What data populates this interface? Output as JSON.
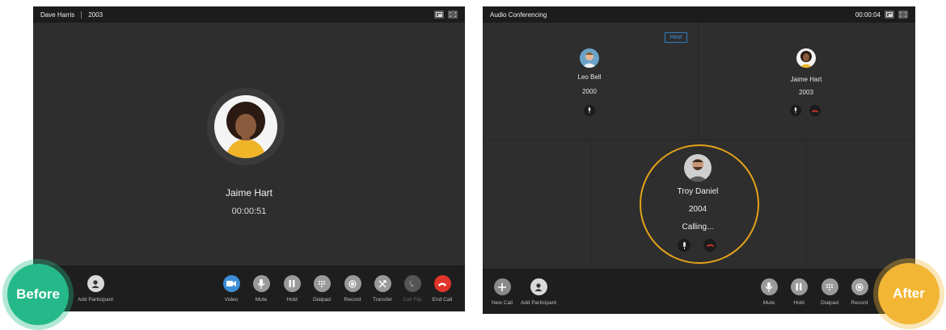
{
  "before": {
    "title_name": "Dave Harris",
    "title_ext": "2003",
    "callee_name": "Jaime Hart",
    "timer": "00:00:51",
    "controls": {
      "add_participant": "Add Participant",
      "video": "Video",
      "mute": "Mute",
      "hold": "Hold",
      "dialpad": "Dialpad",
      "record": "Record",
      "transfer": "Transfer",
      "call_flip": "Call Flip",
      "end_call": "End Call"
    },
    "badge": "Before",
    "badge_color": "#25b98a"
  },
  "after": {
    "title": "Audio Conferencing",
    "timer": "00:00:04",
    "host_tag": "Host",
    "participants": [
      {
        "name": "Leo Bell",
        "ext": "2000"
      },
      {
        "name": "Jaime Hart",
        "ext": "2003"
      },
      {
        "name": "Troy Daniel",
        "ext": "2004",
        "status": "Calling..."
      }
    ],
    "controls": {
      "new_call": "New Call",
      "add_participant": "Add Participant",
      "mute": "Mute",
      "hold": "Hold",
      "dialpad": "Dialpad",
      "record": "Record"
    },
    "badge": "After",
    "badge_color": "#f2b634",
    "highlight_color": "#e3a21a"
  }
}
